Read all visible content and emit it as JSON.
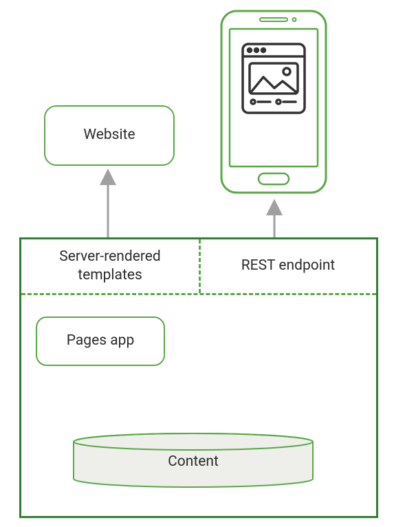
{
  "diagram": {
    "website_label": "Website",
    "container": {
      "left_label": "Server-rendered templates",
      "right_label": "REST endpoint"
    },
    "pages_app_label": "Pages app",
    "content_label": "Content"
  },
  "chart_data": {
    "type": "diagram",
    "title": "",
    "nodes": [
      {
        "id": "website",
        "label": "Website",
        "kind": "consumer"
      },
      {
        "id": "mobile",
        "label": "Mobile device",
        "kind": "consumer"
      },
      {
        "id": "srt",
        "label": "Server-rendered templates",
        "kind": "delivery-layer"
      },
      {
        "id": "rest",
        "label": "REST endpoint",
        "kind": "delivery-layer"
      },
      {
        "id": "pages",
        "label": "Pages app",
        "kind": "app"
      },
      {
        "id": "content",
        "label": "Content",
        "kind": "datastore"
      }
    ],
    "edges": [
      {
        "from": "content",
        "to": "pages",
        "style": "line"
      },
      {
        "from": "content",
        "to": "rest",
        "style": "line"
      },
      {
        "from": "srt",
        "to": "website",
        "style": "arrow"
      },
      {
        "from": "rest",
        "to": "mobile",
        "style": "arrow"
      }
    ],
    "groups": [
      {
        "id": "server",
        "contains": [
          "srt",
          "rest",
          "pages",
          "content"
        ]
      }
    ]
  },
  "colors": {
    "stroke_green": "#59a845",
    "stroke_dark_green": "#308030",
    "arrow_gray": "#a0a0a0",
    "cylinder_fill": "#eeeeea",
    "text": "#2b2b2b",
    "icon_stroke": "#333333"
  }
}
